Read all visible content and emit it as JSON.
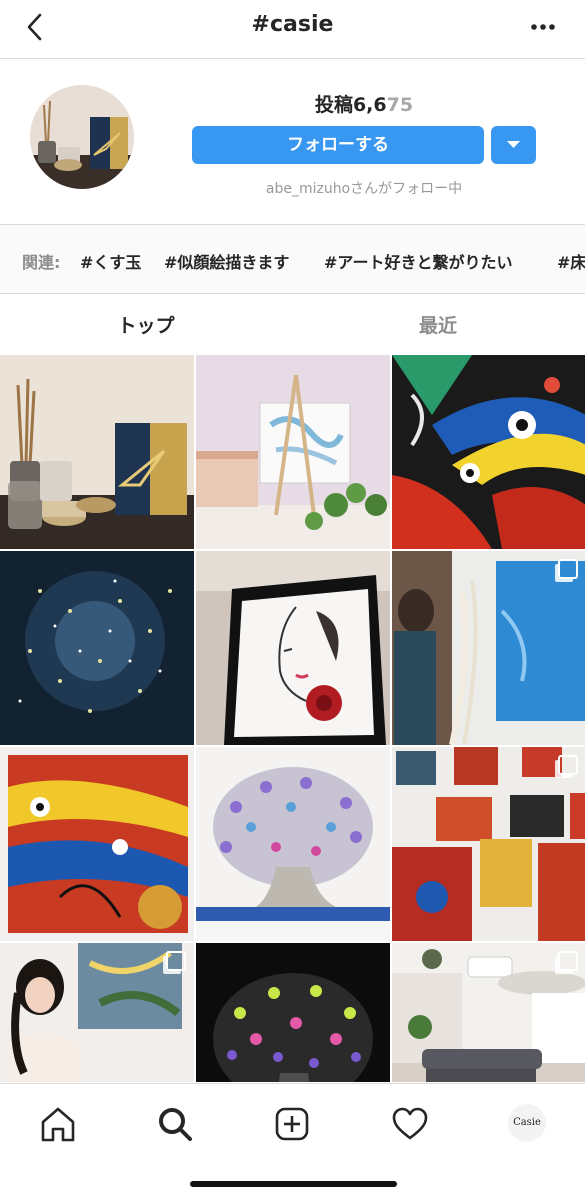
{
  "header": {
    "title": "#casie",
    "back_icon": "chevron-left-icon",
    "more_icon": "ellipsis-icon"
  },
  "profile": {
    "posts_prefix": "投稿6,6",
    "posts_faded": "75",
    "follow_label": "フォローする",
    "dropdown_icon": "caret-down-icon",
    "follow_note": "abe_mizuhoさんがフォロー中"
  },
  "related": {
    "label": "関連:",
    "tags": [
      "#くす玉",
      "#似顔絵描きます",
      "#アート好きと繋がりたい",
      "#床"
    ]
  },
  "tabs": [
    {
      "label": "トップ",
      "active": true
    },
    {
      "label": "最近",
      "active": false
    }
  ],
  "grid": {
    "rows": 4,
    "columns": 3,
    "multi_post_tiles": [
      5,
      8,
      9,
      11
    ]
  },
  "bottom_nav": {
    "items": [
      "home-icon",
      "search-icon",
      "add-post-icon",
      "heart-icon",
      "profile-avatar"
    ],
    "profile_label": "Casie"
  },
  "colors": {
    "accent": "#3897f0",
    "border": "#dbdbdb",
    "muted_text": "#8e8e8e"
  }
}
